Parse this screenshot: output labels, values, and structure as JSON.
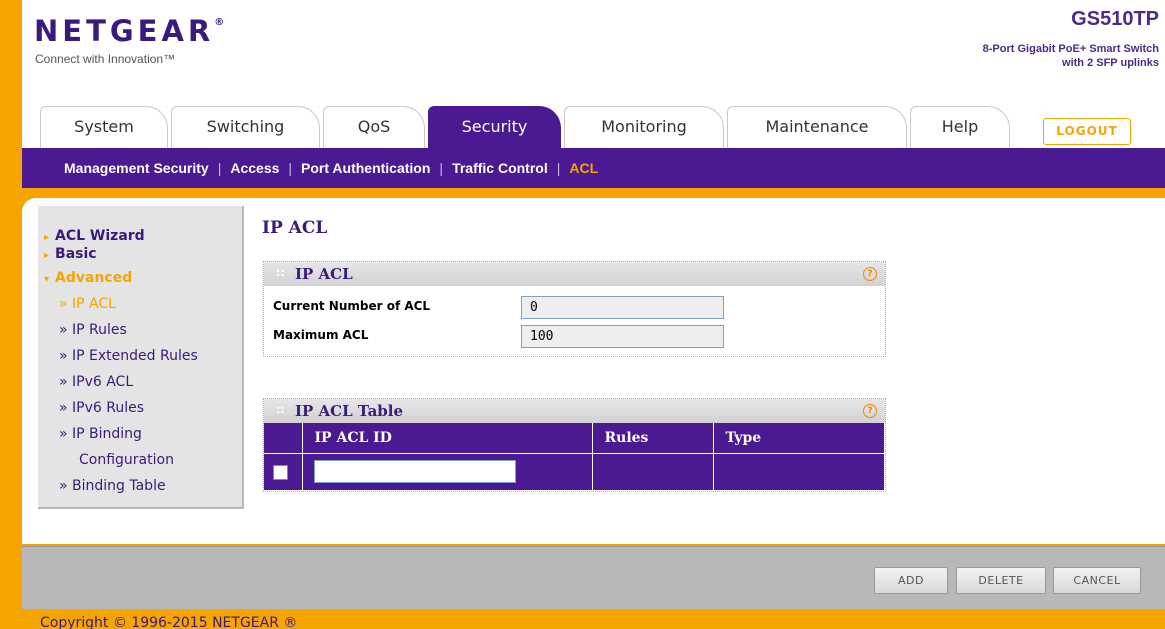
{
  "header": {
    "brand": "NETGEAR",
    "brand_mark": "®",
    "tagline": "Connect with Innovation™",
    "model": "GS510TP",
    "model_desc_line1": "8-Port Gigabit PoE+ Smart Switch",
    "model_desc_line2": "with 2 SFP uplinks"
  },
  "tabs": [
    {
      "label": "System"
    },
    {
      "label": "Switching"
    },
    {
      "label": "QoS"
    },
    {
      "label": "Security",
      "active": true
    },
    {
      "label": "Monitoring"
    },
    {
      "label": "Maintenance"
    },
    {
      "label": "Help"
    }
  ],
  "logout_label": "LOGOUT",
  "subnav": [
    {
      "label": "Management Security"
    },
    {
      "label": "Access"
    },
    {
      "label": "Port Authentication"
    },
    {
      "label": "Traffic Control"
    },
    {
      "label": "ACL",
      "active": true
    }
  ],
  "subnav_separator": "|",
  "sidebar": {
    "acl_wizard": "ACL Wizard",
    "basic": "Basic",
    "advanced": "Advanced",
    "ip_acl": "IP ACL",
    "ip_rules": "IP Rules",
    "ip_extended_rules": "IP Extended Rules",
    "ipv6_acl": "IPv6 ACL",
    "ipv6_rules": "IPv6 Rules",
    "ip_binding_1": "IP Binding",
    "ip_binding_2": "Configuration",
    "binding_table": "Binding Table"
  },
  "page_title": "IP ACL",
  "ip_acl_panel": {
    "title": "IP ACL",
    "current_label": "Current Number of ACL",
    "current_value": "0",
    "max_label": "Maximum ACL",
    "max_value": "100"
  },
  "table_panel": {
    "title": "IP ACL Table",
    "columns": [
      "IP ACL ID",
      "Rules",
      "Type"
    ],
    "id_input_value": ""
  },
  "help_glyph": "?",
  "buttons": {
    "add": "ADD",
    "delete": "DELETE",
    "cancel": "CANCEL"
  },
  "copyright": "Copyright © 1996-2015 NETGEAR ®",
  "colors": {
    "brand_purple": "#4b1991",
    "accent_orange": "#f6a500"
  }
}
